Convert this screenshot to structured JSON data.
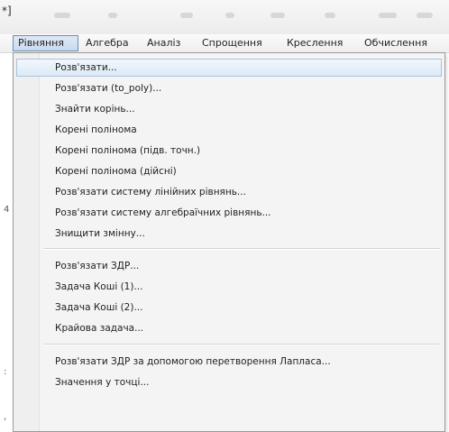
{
  "window": {
    "title_fragment": "*]"
  },
  "menubar": {
    "items": [
      {
        "label": "Рівняння"
      },
      {
        "label": "Алгебра"
      },
      {
        "label": "Аналіз"
      },
      {
        "label": "Спрощення"
      },
      {
        "label": "Креслення"
      },
      {
        "label": "Обчислення"
      }
    ],
    "active_index": 0
  },
  "dropdown": {
    "highlighted_index": 0,
    "groups": [
      [
        {
          "label": "Розв'язати..."
        },
        {
          "label": "Розв'язати (to_poly)..."
        },
        {
          "label": "Знайти корінь..."
        },
        {
          "label": "Корені полінома"
        },
        {
          "label": "Корені полінома (підв. точн.)"
        },
        {
          "label": "Корені полінома (дійсні)"
        },
        {
          "label": "Розв'язати систему лінійних рівнянь..."
        },
        {
          "label": "Розв'язати систему алгебраїчних рівнянь..."
        },
        {
          "label": "Знищити змінну..."
        }
      ],
      [
        {
          "label": "Розв'язати ЗДР..."
        },
        {
          "label": "Задача Коші (1)..."
        },
        {
          "label": "Задача Коші (2)..."
        },
        {
          "label": "Крайова задача..."
        }
      ],
      [
        {
          "label": "Розв'язати ЗДР за допомогою перетворення Лапласа..."
        },
        {
          "label": "Значення у точці..."
        }
      ]
    ]
  },
  "editor": {
    "margin_marks": [
      "4",
      ":",
      ","
    ]
  },
  "colors": {
    "menu_background": "#f4f4f4",
    "highlight_border": "#a9c3de",
    "active_menubar_border": "#6b8fb8"
  }
}
